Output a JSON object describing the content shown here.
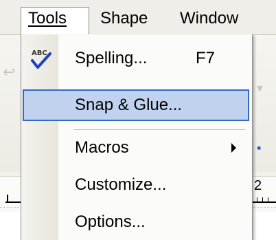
{
  "menubar": {
    "items": [
      {
        "label": "Tools",
        "active": true
      },
      {
        "label": "Shape",
        "active": false
      },
      {
        "label": "Window",
        "active": false
      }
    ]
  },
  "tools_menu": {
    "items": [
      {
        "label": "Spelling...",
        "shortcut": "F7",
        "icon": "spell-check-icon",
        "icon_text": "ABC"
      },
      {
        "label": "Snap & Glue...",
        "highlighted": true
      },
      {
        "label": "Macros",
        "submenu": true
      },
      {
        "label": "Customize..."
      },
      {
        "label": "Options..."
      }
    ]
  },
  "ruler": {
    "label": "2"
  },
  "colors": {
    "highlight_bg": "#c1d2ee",
    "highlight_border": "#316ac5",
    "check_blue": "#1f3fbf"
  }
}
